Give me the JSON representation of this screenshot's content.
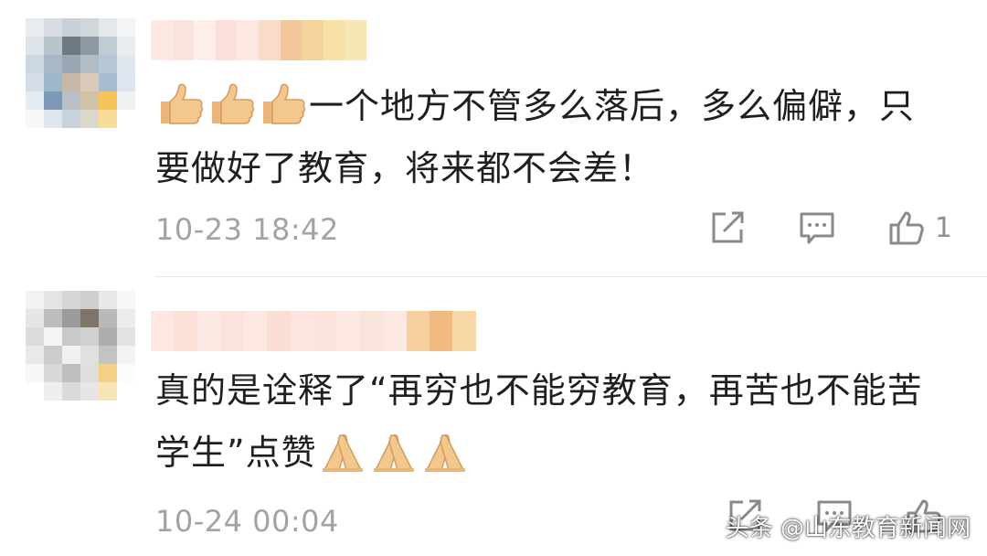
{
  "comments": [
    {
      "text": "一个地方不管多么落后，多么偏僻，只要做好了教育，将来都不会差！",
      "time": "10-23 18:42",
      "like_count": "1",
      "leading_emoji": [
        "thumbs-up",
        "thumbs-up",
        "thumbs-up"
      ]
    },
    {
      "text": "真的是诠释了“再穷也不能穷教育，再苦也不能苦学生”点赞",
      "time": "10-24 00:04",
      "like_count": "",
      "trailing_emoji": [
        "pray",
        "pray",
        "pray"
      ]
    }
  ],
  "watermark": "头条 @山东教育新闻网",
  "icons": {
    "share": "share-icon",
    "reply": "comment-icon",
    "like": "thumbs-up-icon",
    "clap": "praying-hands-emoji"
  },
  "colors": {
    "text": "#1f1f1f",
    "meta": "#a3a3a3",
    "icon": "#8a8a8a",
    "divider": "#e6e6e6",
    "emoji_skin": "#f3c88f"
  }
}
